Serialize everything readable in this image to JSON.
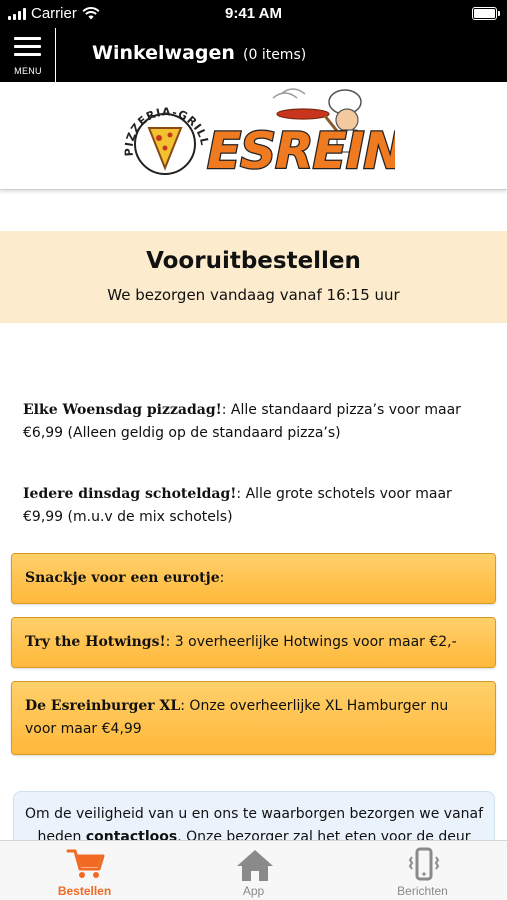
{
  "status_bar": {
    "carrier": "Carrier",
    "time": "9:41 AM"
  },
  "nav": {
    "menu_label": "MENU",
    "title": "Winkelwagen",
    "item_count": "(0 items)"
  },
  "logo": {
    "wordmark": "ESREIN",
    "arc_text": "PIZZERIA-GRILLROOM"
  },
  "preorder": {
    "title": "Vooruitbestellen",
    "subtitle": "We bezorgen vandaag vanaf 16:15 uur"
  },
  "promos": [
    {
      "title": "Elke Woensdag pizzadag!",
      "text": ": Alle standaard pizza’s voor maar €6,99 (Alleen geldig op de standaard pizza’s)"
    },
    {
      "title": "Iedere dinsdag schoteldag!",
      "text": ": Alle grote schotels voor maar €9,99 (m.u.v de mix schotels)"
    }
  ],
  "cards": [
    {
      "title": "Snackje voor een eurotje",
      "text": ":"
    },
    {
      "title": "Try the Hotwings!",
      "text": ": 3 overheerlijke Hotwings voor maar €2,-"
    },
    {
      "title": "De Esreinburger XL",
      "text": ": Onze overheerlijke XL Hamburger nu voor maar €4,99"
    }
  ],
  "safety": {
    "text_before": "Om de veiligheid van u en ons te waarborgen bezorgen we vanaf heden ",
    "bold": "contactloos",
    "text_after": ". Onze bezorger zal het eten voor de deur"
  },
  "tabs": [
    {
      "label": "Bestellen",
      "icon": "cart-icon",
      "active": true
    },
    {
      "label": "App",
      "icon": "home-icon",
      "active": false
    },
    {
      "label": "Berichten",
      "icon": "phone-vibrate-icon",
      "active": false
    }
  ],
  "colors": {
    "accent": "#f06a24",
    "card": "#ffc24d",
    "banner": "#fdebcd",
    "bar": "#000000"
  }
}
